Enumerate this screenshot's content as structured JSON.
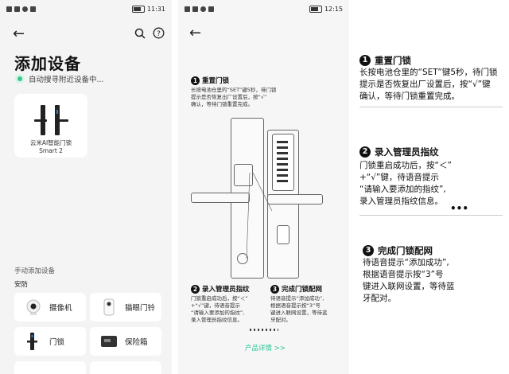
{
  "left_phone": {
    "status_time": "11:31",
    "title": "添加设备",
    "scanning_text": "自动搜寻附近设备中...",
    "device": {
      "name_line1": "云米AI智能门锁",
      "name_line2": "Smart 2"
    },
    "manual_section": "手动添加设备",
    "category": "安防",
    "tiles": [
      {
        "label": "摄像机",
        "icon": "camera-icon"
      },
      {
        "label": "猫眼门铃",
        "icon": "doorbell-icon"
      },
      {
        "label": "门锁",
        "icon": "door-lock-icon"
      },
      {
        "label": "保险箱",
        "icon": "safe-icon"
      }
    ]
  },
  "right_phone": {
    "status_time": "12:15",
    "step1_title": "重置门锁",
    "step1_text": [
      "长按电池仓里的“SET”键5秒，待门锁",
      "提示是否恢复出厂设置后，按“√”",
      "确认，等待门锁重置完成。"
    ],
    "step2_title": "录入管理员指纹",
    "step2_text": [
      "门锁重启成功后，按“＜”",
      "+“√”键，待语音提示",
      "“请输入要添加的指纹”,",
      "录入管理员指纹信息。"
    ],
    "step3_title": "完成门锁配网",
    "step3_text": [
      "待语音提示“添加成功”,",
      "根据语音提示按“3”号",
      "键进入联网设置，等待蓝",
      "牙配对。"
    ],
    "link": "产品详情 >>"
  },
  "annotations": [
    {
      "num": "1",
      "title": "重置门锁",
      "lines": [
        "长按电池仓里的“SET”键5秒，待门锁",
        "提示是否恢复出厂设置后，按“√”键",
        "确认，等待门锁重置完成。"
      ]
    },
    {
      "num": "2",
      "title": "录入管理员指纹",
      "lines": [
        "门锁重启成功后，按“＜”",
        "+“√”键，待语音提示",
        "“请输入要添加的指纹”,",
        "录入管理员指纹信息。"
      ]
    },
    {
      "num": "3",
      "title": "完成门锁配网",
      "lines": [
        "待语音提示“添加成功”,",
        "根据语音提示按“3”号",
        "键进入联网设置，等待蓝",
        "牙配对。"
      ]
    }
  ],
  "colors": {
    "accent": "#2fc49a",
    "scan_dot": "#37c98f",
    "phone_bg": "#f4f4f4"
  }
}
